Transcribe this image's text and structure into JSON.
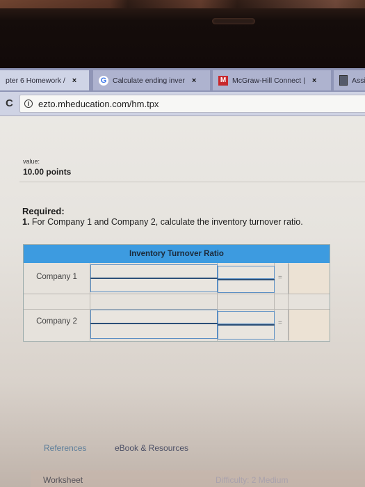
{
  "browser": {
    "tabs": [
      {
        "label": "pter 6 Homework /",
        "favicon": "none",
        "active": true
      },
      {
        "label": "Calculate ending inver",
        "favicon": "google-g-icon",
        "active": false
      },
      {
        "label": "McGraw-Hill Connect |",
        "favicon": "mcgraw-hill-m-icon",
        "active": false
      },
      {
        "label": "Assig",
        "favicon": "document-icon",
        "active": false
      }
    ],
    "close_glyph": "×",
    "reload_glyph": "C",
    "info_glyph": "i",
    "url": "ezto.mheducation.com/hm.tpx",
    "favicon_g": "G",
    "favicon_m": "M"
  },
  "question": {
    "value_label": "value:",
    "value_points": "10.00 points",
    "required_label": "Required:",
    "instruction_number": "1.",
    "instruction_text": " For Company 1 and Company 2, calculate the inventory turnover ratio."
  },
  "ratio_table": {
    "header": "Inventory Turnover Ratio",
    "rows": [
      {
        "label": "Company 1",
        "numerator_left": "",
        "denominator_left": "",
        "numerator_right": "",
        "denominator_right": "",
        "equals": "=",
        "result": ""
      },
      {
        "label": "Company 2",
        "numerator_left": "",
        "denominator_left": "",
        "numerator_right": "",
        "denominator_right": "",
        "equals": "=",
        "result": ""
      }
    ]
  },
  "footer": {
    "references_label": "References",
    "ebook_label": "eBook & Resources",
    "worksheet_label": "Worksheet",
    "difficulty_label": "Difficulty: 2 Medium"
  },
  "colors": {
    "table_header": "#3d9be0",
    "tab_strip": "#8f95b6",
    "favicon_m": "#c8282c"
  }
}
